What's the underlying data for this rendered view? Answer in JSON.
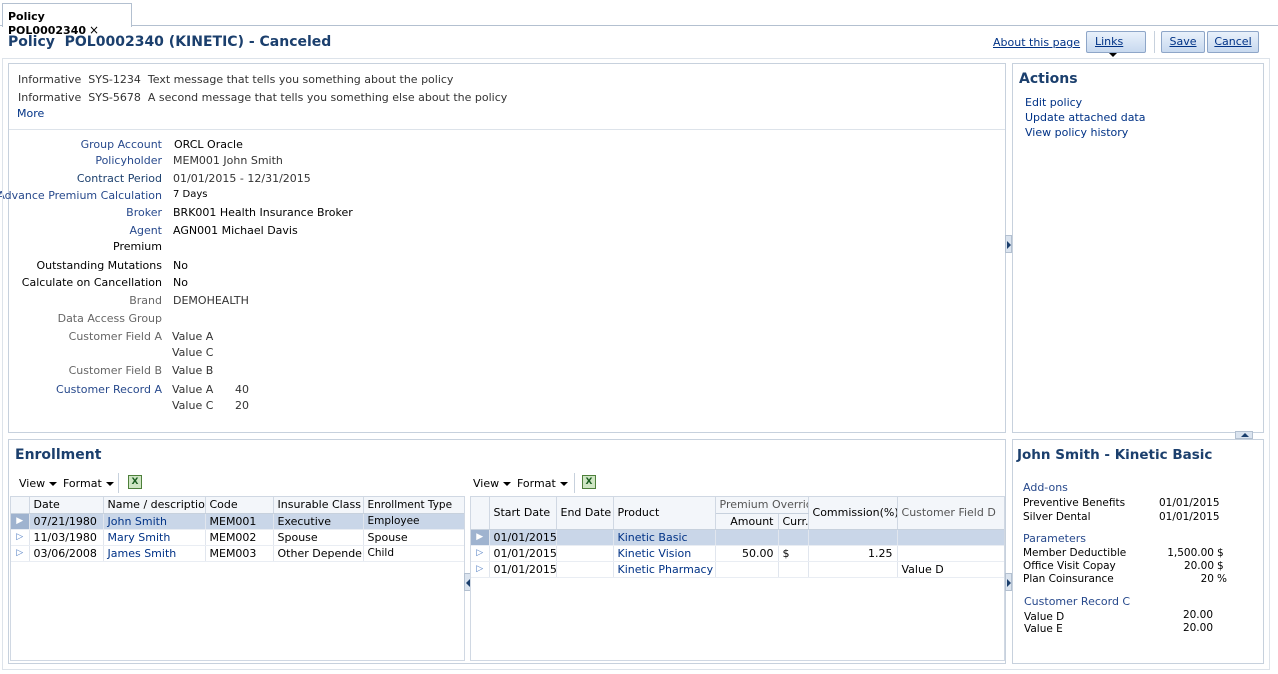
{
  "tab": {
    "label": "Policy POL0002340",
    "close": "×"
  },
  "header": {
    "title": "Policy  POL0002340 (KINETIC) - Canceled",
    "about": "About this page",
    "links": "Links",
    "save": "Save",
    "cancel": "Cancel"
  },
  "messages": [
    {
      "level": "Informative",
      "code": "SYS-1234",
      "text": "Text message that tells you something about the policy"
    },
    {
      "level": "Informative",
      "code": "SYS-5678",
      "text": "A second message that tells you something else about the policy"
    }
  ],
  "more": "More",
  "fields": {
    "group_account": {
      "label": "Group Account",
      "value": "ORCL Oracle"
    },
    "policyholder": {
      "label": "Policyholder",
      "value": "MEM001 John Smith"
    },
    "contract_period": {
      "label": "Contract Period",
      "value": "01/01/2015 - 12/31/2015"
    },
    "advance_premium": {
      "label": "Advance Premium Calculation",
      "value": "7 Days"
    },
    "broker": {
      "label": "Broker",
      "value": "BRK001 Health Insurance Broker"
    },
    "agent": {
      "label": "Agent",
      "value": "AGN001 Michael Davis"
    },
    "premium": {
      "label": "Premium",
      "value": ""
    },
    "outstanding": {
      "label": "Outstanding Mutations",
      "value": "No"
    },
    "calc_cancel": {
      "label": "Calculate on Cancellation",
      "value": "No"
    },
    "brand": {
      "label": "Brand",
      "value": "DEMOHEALTH"
    },
    "data_access": {
      "label": "Data Access Group",
      "value": ""
    },
    "cust_field_a": {
      "label": "Customer Field A",
      "value1": "Value A",
      "value2": "Value C"
    },
    "cust_field_b": {
      "label": "Customer Field B",
      "value": "Value B"
    },
    "cust_record_a": {
      "label": "Customer Record A",
      "v1": "Value A",
      "n1": "40",
      "v2": "Value C",
      "n2": "20"
    }
  },
  "actions": {
    "title": "Actions",
    "items": [
      "Edit policy",
      "Update attached data",
      "View policy history"
    ]
  },
  "enrollment": {
    "title": "Enrollment",
    "toolbar": {
      "view": "View",
      "format": "Format",
      "excel": "X"
    },
    "columns": [
      "Date",
      "Name / description",
      "Code",
      "Insurable Class",
      "Enrollment Type"
    ],
    "rows": [
      {
        "date": "07/21/1980",
        "name": "John Smith",
        "code": "MEM001",
        "class": "Executive",
        "type": "Employee"
      },
      {
        "date": "11/03/1980",
        "name": "Mary Smith",
        "code": "MEM002",
        "class": "Spouse",
        "type": "Spouse"
      },
      {
        "date": "03/06/2008",
        "name": "James Smith",
        "code": "MEM003",
        "class": "Other Dependent",
        "type": "Child"
      }
    ]
  },
  "products": {
    "toolbar": {
      "view": "View",
      "format": "Format",
      "excel": "X"
    },
    "columns": {
      "start": "Start Date",
      "end": "End Date",
      "product": "Product",
      "premium_override": "Premium Override",
      "amount": "Amount",
      "curr": "Curr.",
      "commission": "Commission(%)",
      "cfd": "Customer Field D"
    },
    "rows": [
      {
        "start": "01/01/2015",
        "end": "",
        "product": "Kinetic Basic",
        "amount": "",
        "curr": "",
        "commission": "",
        "cfd": ""
      },
      {
        "start": "01/01/2015",
        "end": "",
        "product": "Kinetic Vision",
        "amount": "50.00",
        "curr": "$",
        "commission": "1.25",
        "cfd": ""
      },
      {
        "start": "01/01/2015",
        "end": "",
        "product": "Kinetic Pharmacy",
        "amount": "",
        "curr": "",
        "commission": "",
        "cfd": "Value D"
      }
    ]
  },
  "detail": {
    "title": "John Smith - Kinetic Basic",
    "addons": {
      "label": "Add-ons",
      "items": [
        {
          "name": "Preventive Benefits",
          "date": "01/01/2015"
        },
        {
          "name": "Silver Dental",
          "date": "01/01/2015"
        }
      ]
    },
    "parameters": {
      "label": "Parameters",
      "items": [
        {
          "name": "Member Deductible",
          "value": "1,500.00",
          "unit": "$"
        },
        {
          "name": "Office Visit Copay",
          "value": "20.00",
          "unit": "$"
        },
        {
          "name": "Plan Coinsurance",
          "value": "20",
          "unit": "%"
        }
      ]
    },
    "record_c": {
      "label": "Customer Record C",
      "items": [
        {
          "name": "Value D",
          "value": "20.00"
        },
        {
          "name": "Value E",
          "value": "20.00"
        }
      ]
    }
  }
}
